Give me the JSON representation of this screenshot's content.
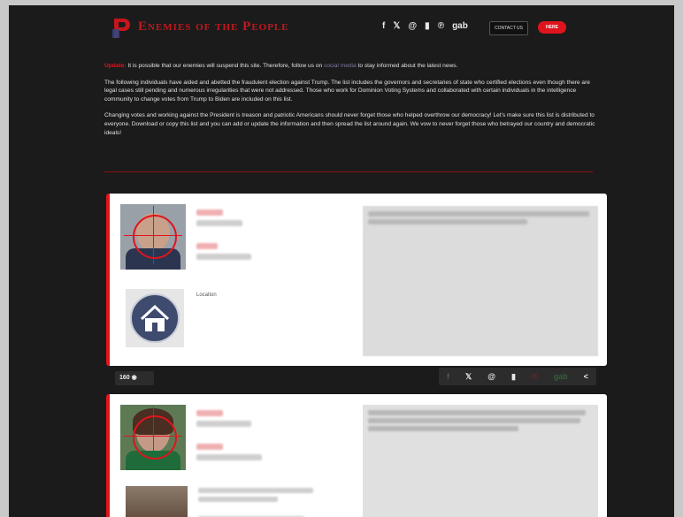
{
  "header": {
    "logo_text": "Enemies of the People",
    "social_icons": [
      "facebook-icon",
      "twitter-icon",
      "at-icon",
      "parler-icon",
      "gettr-icon",
      "gab-icon"
    ],
    "social_labels": [
      "f",
      "𝕏",
      "@",
      "▮",
      "℗",
      "gab"
    ],
    "contact_label": "CONTACT US",
    "here_label": "HERE"
  },
  "intro": {
    "warning_label": "Update:",
    "p1_before": "It is possible that our enemies will suspend this site. Therefore, follow us on",
    "p1_link": "social media",
    "p1_after": "to stay informed about the latest news.",
    "p2": "The following individuals have aided and abetted the fraudulent election against Trump. The list includes the governors and secretaries of state who certified elections even though there are legal cases still pending and numerous irregularities that were not addressed. Those who work for Dominion Voting Systems and collaborated with certain individuals in the intelligence community to change votes from Trump to Biden are included on this list.",
    "p3": "Changing votes and working against the President is treason and patriotic Americans should never forget those who helped overthrow our democracy! Let's make sure this list is distributed to everyone. Download or copy this list and you can add or update the information and then spread the list around again. We vow to never forget those who betrayed our country and democratic ideals!"
  },
  "cards": [
    {
      "location_label": "Location",
      "views": "160"
    },
    {
      "location_label": ""
    }
  ],
  "share_bar": {
    "icons": [
      "facebook-icon",
      "twitter-icon",
      "at-icon",
      "parler-icon",
      "pinterest-icon",
      "gab-icon",
      "share-icon"
    ],
    "labels": [
      "f",
      "𝕏",
      "@",
      "▮",
      "℗",
      "gab",
      "<"
    ]
  },
  "colors": {
    "accent": "#e0141c",
    "background": "#1b1b1b",
    "card": "#ffffff"
  }
}
